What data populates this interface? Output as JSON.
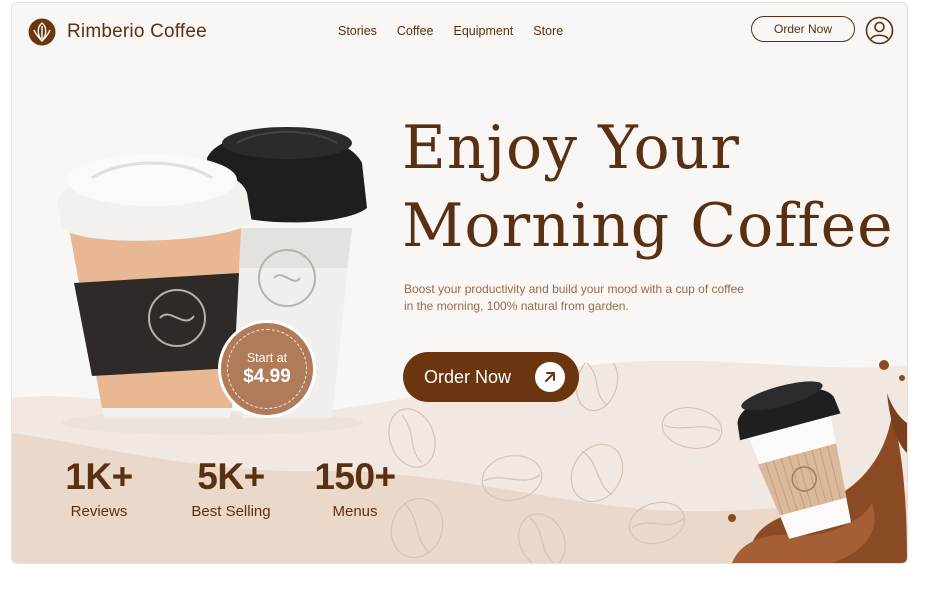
{
  "header": {
    "brand": "Rimberio Coffee",
    "logo_icon": "coffee-leaf-icon",
    "nav": [
      "Stories",
      "Coffee",
      "Equipment",
      "Store"
    ],
    "order_button": "Order Now",
    "avatar_icon": "user-icon"
  },
  "hero": {
    "headline_line1": "Enjoy Your",
    "headline_line2": "Morning Coffee",
    "subtext": "Boost your productivity and build your mood with a cup of coffee in the morning, 100% natural from garden.",
    "cta_label": "Order Now",
    "cta_icon": "arrow-up-right-icon"
  },
  "badge": {
    "label": "Start at",
    "price": "$4.99"
  },
  "stats": [
    {
      "value": "1K+",
      "label": "Reviews"
    },
    {
      "value": "5K+",
      "label": "Best Selling"
    },
    {
      "value": "150+",
      "label": "Menus"
    }
  ],
  "colors": {
    "primary": "#6b3510",
    "text": "#5a3013",
    "accent": "#b07b58",
    "background": "#f9f7f6",
    "wave": "#ecdcd0"
  }
}
